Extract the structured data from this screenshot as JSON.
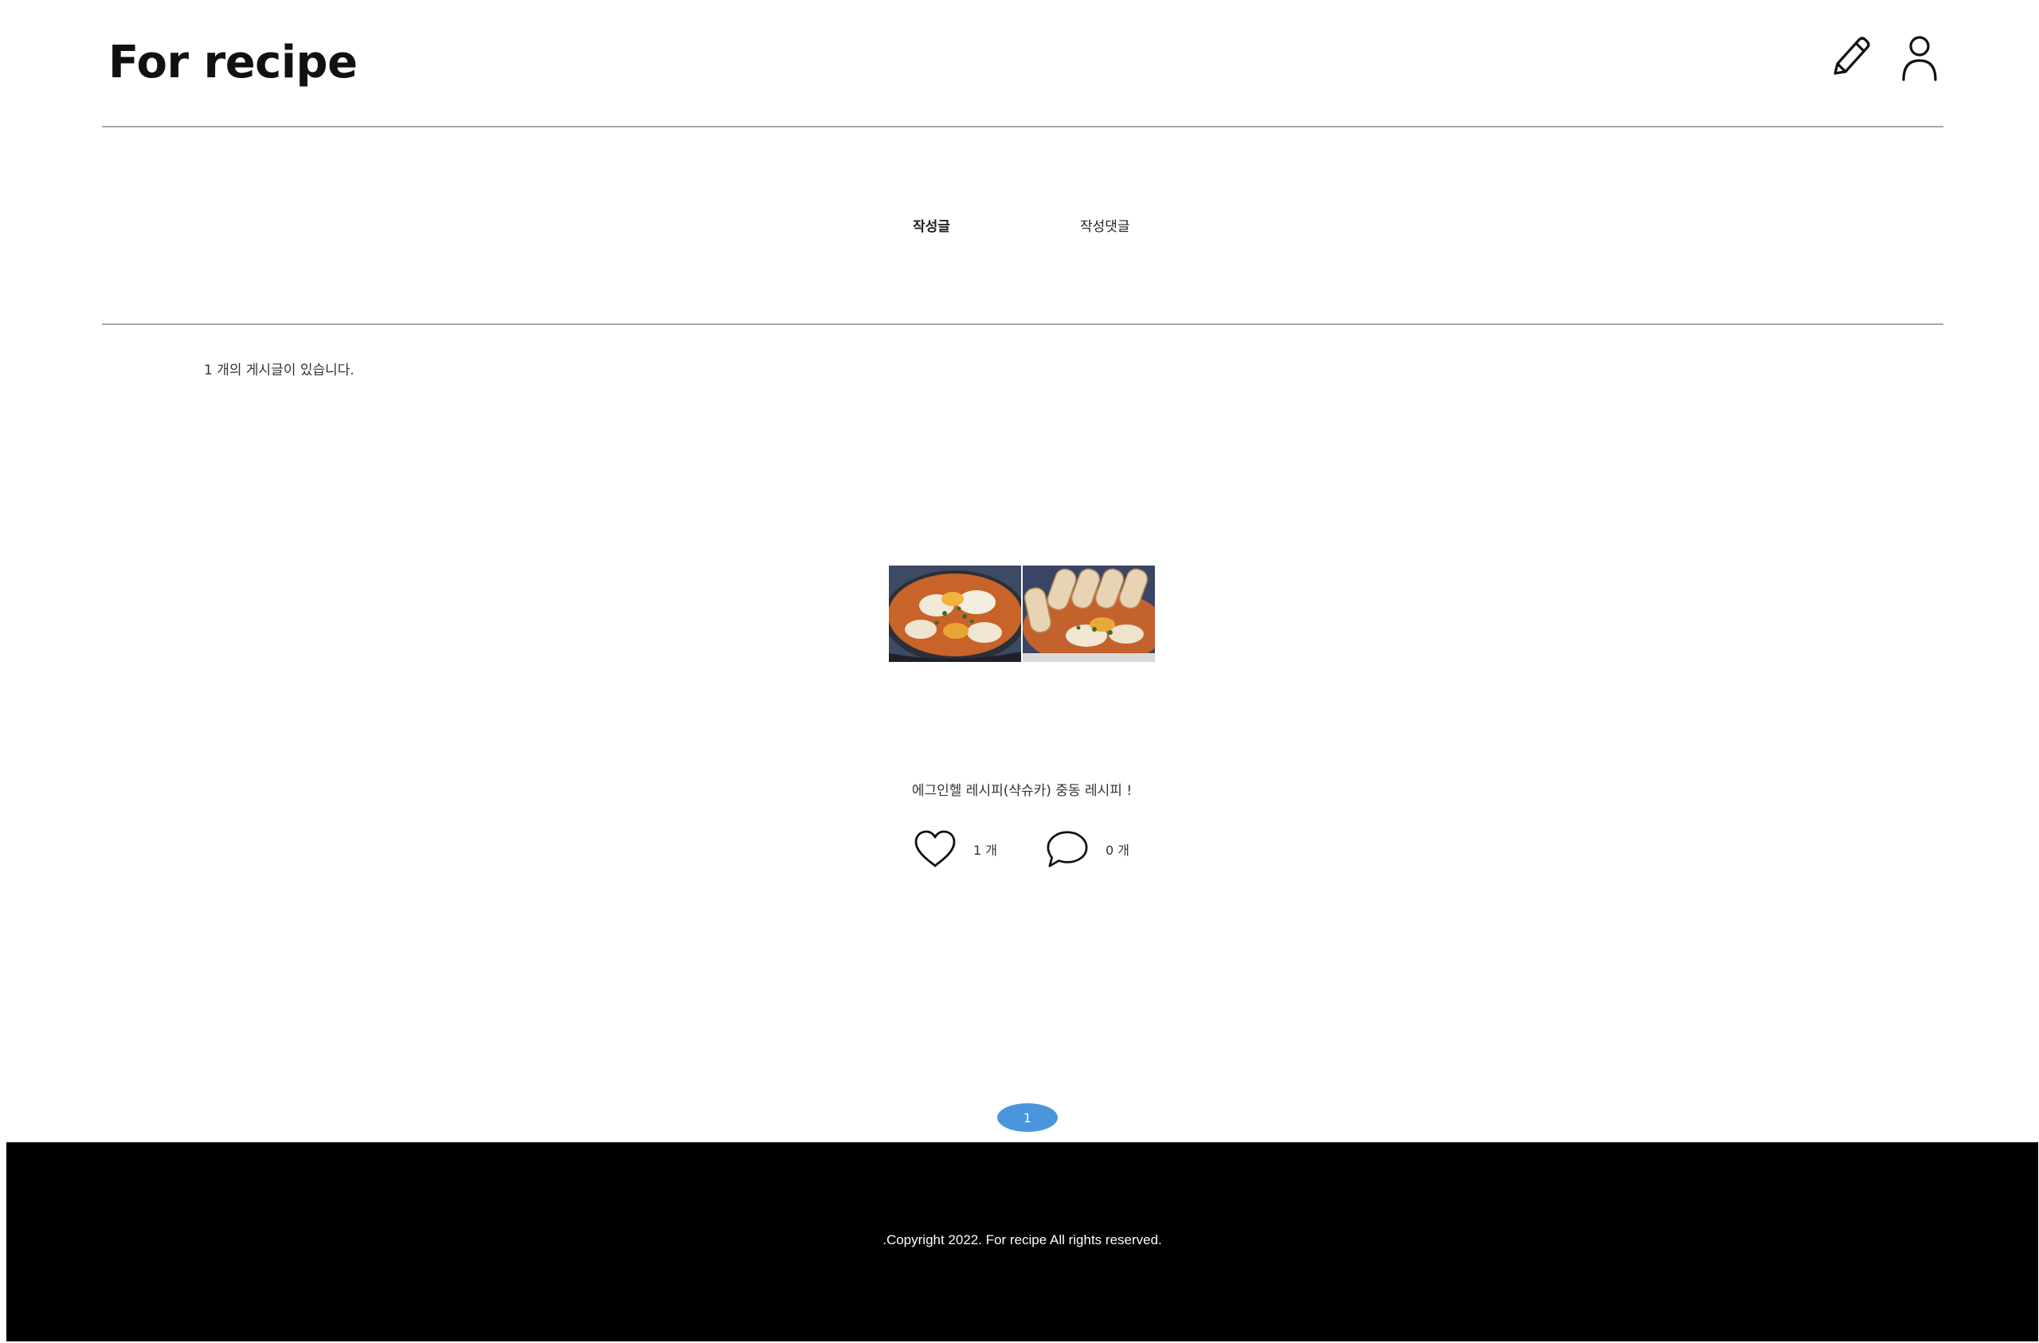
{
  "header": {
    "logo": "For recipe",
    "icons": [
      "pencil-icon",
      "user-icon"
    ]
  },
  "tabs": [
    {
      "label": "작성글",
      "active": true
    },
    {
      "label": "작성댓글",
      "active": false
    }
  ],
  "post_count_text": "1 개의 게시글이 있습니다.",
  "posts": [
    {
      "title": "에그인헬 레시피(샥슈카) 중동 레시피 !",
      "likes_text": "1 개",
      "comments_text": "0 개"
    }
  ],
  "pagination": {
    "current_page": "1"
  },
  "footer": {
    "copyright": ".Copyright 2022. For recipe All rights reserved."
  },
  "colors": {
    "accent": "#4a96dc",
    "footer_bg": "#000000",
    "divider": "#a8a8a8"
  }
}
